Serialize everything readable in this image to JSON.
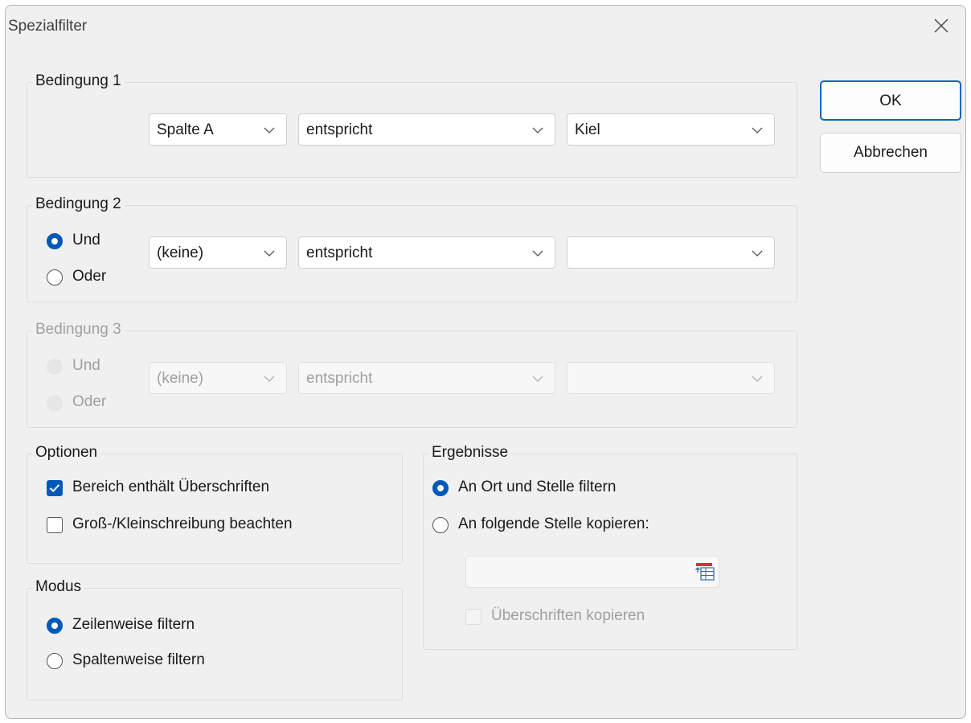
{
  "dialog": {
    "title": "Spezialfilter"
  },
  "buttons": {
    "ok": "OK",
    "cancel": "Abbrechen"
  },
  "condition1": {
    "title": "Bedingung 1",
    "field": "Spalte A",
    "operator": "entspricht",
    "value": "Kiel"
  },
  "condition2": {
    "title": "Bedingung 2",
    "and_label": "Und",
    "or_label": "Oder",
    "selected": "Und",
    "field": "(keine)",
    "operator": "entspricht",
    "value": ""
  },
  "condition3": {
    "title": "Bedingung 3",
    "enabled": false,
    "and_label": "Und",
    "or_label": "Oder",
    "field": "(keine)",
    "operator": "entspricht",
    "value": ""
  },
  "options": {
    "title": "Optionen",
    "range_has_headers": {
      "label": "Bereich enthält Überschriften",
      "checked": true
    },
    "case_sensitive": {
      "label": "Groß-/Kleinschreibung beachten",
      "checked": false
    }
  },
  "mode": {
    "title": "Modus",
    "rows_label": "Zeilenweise filtern",
    "columns_label": "Spaltenweise filtern",
    "selected": "Zeilenweise filtern"
  },
  "results": {
    "title": "Ergebnisse",
    "in_place_label": "An Ort und Stelle filtern",
    "copy_label": "An folgende Stelle kopieren:",
    "selected": "An Ort und Stelle filtern",
    "target_value": "",
    "copy_headers": {
      "label": "Überschriften kopieren",
      "checked": false,
      "enabled": false
    }
  },
  "icons": {
    "close": "close-icon",
    "dropdown": "chevron-down-icon",
    "range_picker": "range-select-icon",
    "check": "checkmark-icon"
  },
  "colors": {
    "accent": "#0059b8",
    "default_button_border": "#0067c0",
    "range_icon_red": "#d13438"
  }
}
